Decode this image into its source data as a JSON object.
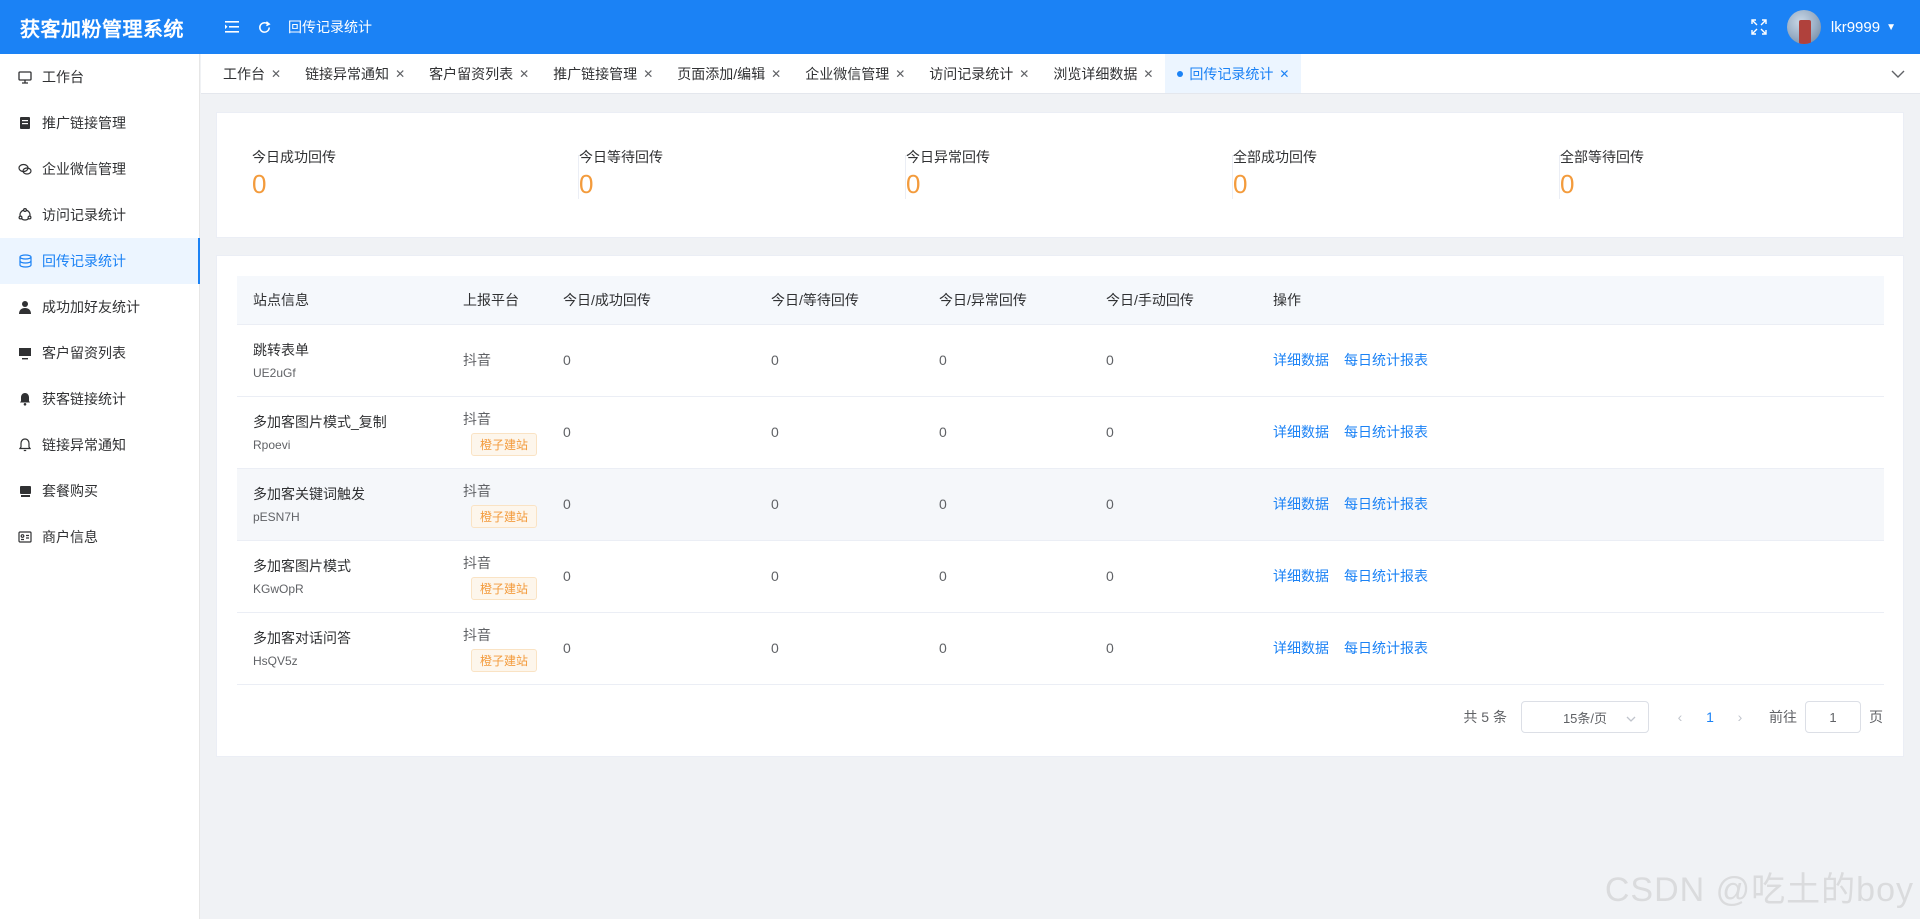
{
  "header": {
    "brand": "获客加粉管理系统",
    "breadcrumb": "回传记录统计",
    "username": "lkr9999"
  },
  "sidebar": {
    "items": [
      {
        "label": "工作台",
        "icon": "monitor-icon"
      },
      {
        "label": "推广链接管理",
        "icon": "document-icon"
      },
      {
        "label": "企业微信管理",
        "icon": "chat-icon"
      },
      {
        "label": "访问记录统计",
        "icon": "cycle-icon"
      },
      {
        "label": "回传记录统计",
        "icon": "coins-icon",
        "active": true
      },
      {
        "label": "成功加好友统计",
        "icon": "user-icon"
      },
      {
        "label": "客户留资列表",
        "icon": "screen-icon"
      },
      {
        "label": "获客链接统计",
        "icon": "bell-icon"
      },
      {
        "label": "链接异常通知",
        "icon": "bell-outline-icon"
      },
      {
        "label": "套餐购买",
        "icon": "box-icon"
      },
      {
        "label": "商户信息",
        "icon": "id-card-icon"
      }
    ]
  },
  "tabs": [
    {
      "label": "工作台"
    },
    {
      "label": "链接异常通知"
    },
    {
      "label": "客户留资列表"
    },
    {
      "label": "推广链接管理"
    },
    {
      "label": "页面添加/编辑"
    },
    {
      "label": "企业微信管理"
    },
    {
      "label": "访问记录统计"
    },
    {
      "label": "浏览详细数据"
    },
    {
      "label": "回传记录统计",
      "active": true
    }
  ],
  "stats": [
    {
      "label": "今日成功回传",
      "value": "0"
    },
    {
      "label": "今日等待回传",
      "value": "0"
    },
    {
      "label": "今日异常回传",
      "value": "0"
    },
    {
      "label": "全部成功回传",
      "value": "0"
    },
    {
      "label": "全部等待回传",
      "value": "0"
    }
  ],
  "table": {
    "columns": [
      "站点信息",
      "上报平台",
      "今日/成功回传",
      "今日/等待回传",
      "今日/异常回传",
      "今日/手动回传",
      "操作"
    ],
    "rows": [
      {
        "name": "跳转表单",
        "code": "UE2uGf",
        "platform": "抖音",
        "badge": "",
        "success": "0",
        "waiting": "0",
        "error": "0",
        "manual": "0"
      },
      {
        "name": "多加客图片模式_复制",
        "code": "Rpoevi",
        "platform": "抖音",
        "badge": "橙子建站",
        "success": "0",
        "waiting": "0",
        "error": "0",
        "manual": "0"
      },
      {
        "name": "多加客关键词触发",
        "code": "pESN7H",
        "platform": "抖音",
        "badge": "橙子建站",
        "success": "0",
        "waiting": "0",
        "error": "0",
        "manual": "0"
      },
      {
        "name": "多加客图片模式",
        "code": "KGwOpR",
        "platform": "抖音",
        "badge": "橙子建站",
        "success": "0",
        "waiting": "0",
        "error": "0",
        "manual": "0"
      },
      {
        "name": "多加客对话问答",
        "code": "HsQV5z",
        "platform": "抖音",
        "badge": "橙子建站",
        "success": "0",
        "waiting": "0",
        "error": "0",
        "manual": "0"
      }
    ],
    "actions": {
      "detail": "详细数据",
      "report": "每日统计报表"
    }
  },
  "pagination": {
    "total": "共 5 条",
    "page_size": "15条/页",
    "current": "1",
    "goto_label": "前往",
    "goto_value": "1",
    "page_suffix": "页"
  },
  "watermark": "CSDN @吃土的boy"
}
